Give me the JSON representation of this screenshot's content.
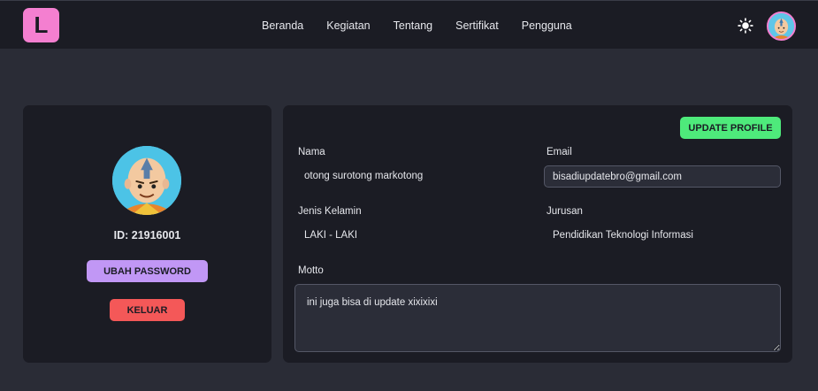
{
  "nav": {
    "logo_letter": "L",
    "links": [
      "Beranda",
      "Kegiatan",
      "Tentang",
      "Sertifikat",
      "Pengguna"
    ],
    "theme_icon": "sun-icon",
    "avatar_icon": "user-avatar-icon"
  },
  "profile": {
    "id_text": "ID: 21916001",
    "change_password_label": "UBAH PASSWORD",
    "logout_label": "KELUAR"
  },
  "form": {
    "update_label": "UPDATE PROFILE",
    "name_label": "Nama",
    "name_value": "otong surotong markotong",
    "email_label": "Email",
    "email_value": "bisadiupdatebro@gmail.com",
    "gender_label": "Jenis Kelamin",
    "gender_value": "LAKI - LAKI",
    "major_label": "Jurusan",
    "major_value": "Pendidikan Teknologi Informasi",
    "motto_label": "Motto",
    "motto_value": "ini juga bisa di update xixixixi"
  },
  "colors": {
    "background": "#2a2c36",
    "surface": "#1b1c24",
    "logo": "#f47fd0",
    "password_button": "#c197f5",
    "logout_button": "#f45858",
    "update_button": "#4eea7b"
  }
}
